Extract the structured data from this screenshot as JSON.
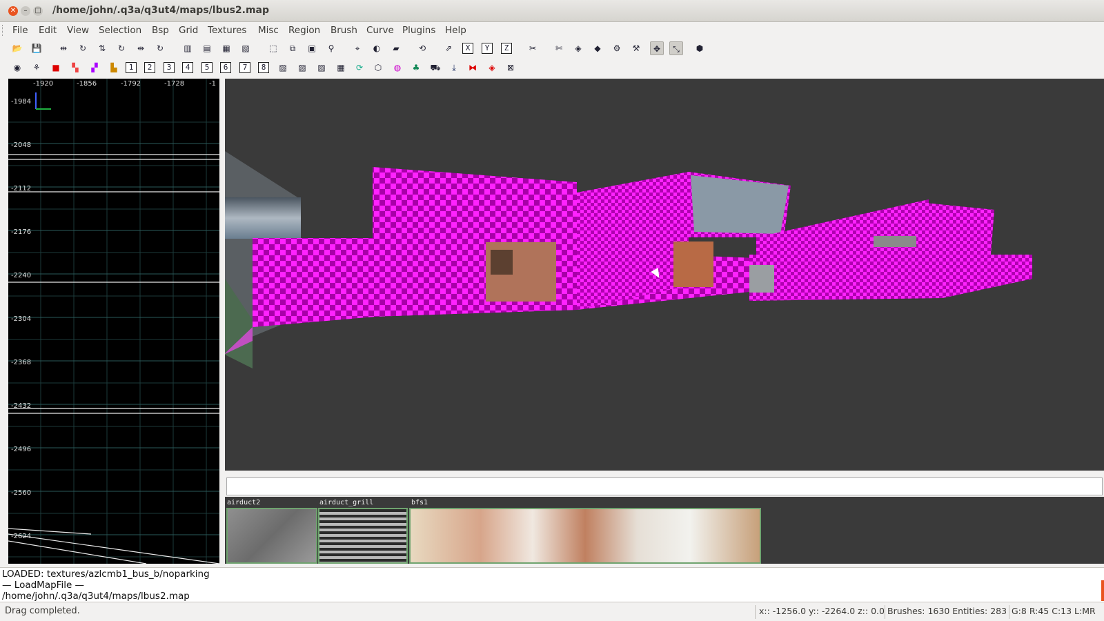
{
  "window": {
    "title": "/home/john/.q3a/q3ut4/maps/lbus2.map"
  },
  "menu": [
    "File",
    "Edit",
    "View",
    "Selection",
    "Bsp",
    "Grid",
    "Textures",
    "Misc",
    "Region",
    "Brush",
    "Curve",
    "Plugins",
    "Help"
  ],
  "toolbar2_numbers": [
    "1",
    "2",
    "3",
    "4",
    "5",
    "6",
    "7",
    "8"
  ],
  "toolbar1_xyz": [
    "X",
    "Y",
    "Z"
  ],
  "grid_view": {
    "x_labels": [
      "-1920",
      "-1856",
      "-1792",
      "-1728",
      "-1"
    ],
    "y_labels": [
      "-1984",
      "-2048",
      "-2112",
      "-2176",
      "-2240",
      "-2304",
      "-2368",
      "-2432",
      "-2496",
      "-2560",
      "-2624"
    ]
  },
  "texture_browser": {
    "filter_value": "",
    "textures": [
      {
        "name": "airduct2"
      },
      {
        "name": "airduct_grill"
      },
      {
        "name": "bfs1"
      }
    ]
  },
  "console": {
    "lines": [
      "LOADED: textures/azlcmb1_bus_b/noparking",
      "— LoadMapFile —",
      "/home/john/.q3a/q3ut4/maps/lbus2.map"
    ]
  },
  "status": {
    "message": "Drag completed.",
    "coords": "x:: -1256.0  y:: -2264.0  z:: 0.0",
    "counts": "Brushes: 1630 Entities: 283",
    "grid": "G:8 R:45 C:13 L:MR"
  },
  "colors": {
    "accent": "#e95420",
    "missing_texture": "#ff00ff",
    "viewport_bg": "#3a3a3a"
  }
}
